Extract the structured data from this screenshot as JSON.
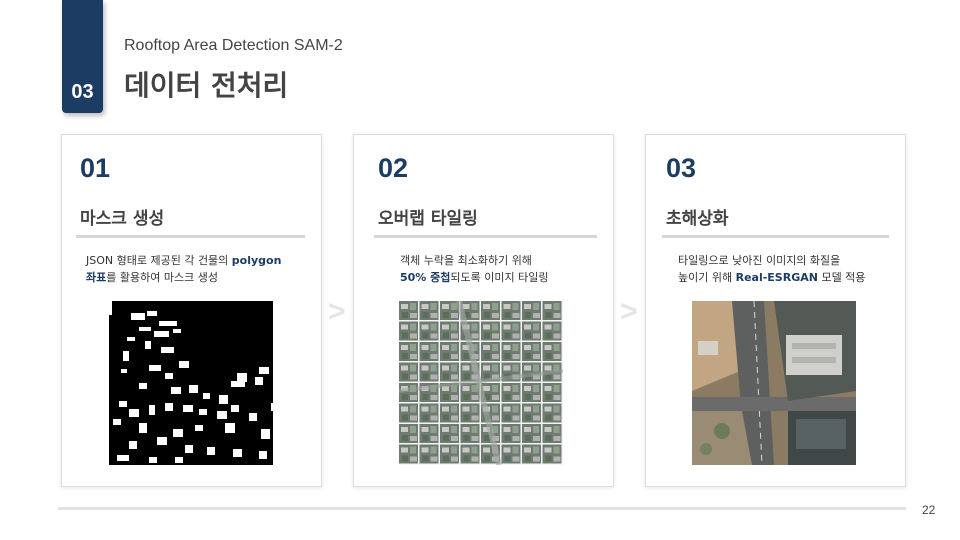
{
  "section": {
    "number": "03",
    "subtitle": "Rooftop Area Detection SAM-2",
    "title": "데이터 전처리"
  },
  "steps": [
    {
      "number": "01",
      "heading": "마스크 생성",
      "desc": {
        "line1_plain": "JSON 형태로 제공된 각 건물의 ",
        "line1_bold": "polygon",
        "line2_bold": "좌표",
        "line2_plain": "를 활용하여 마스크 생성"
      },
      "image": "binary-mask-image"
    },
    {
      "number": "02",
      "heading": "오버랩 타일링",
      "desc": {
        "line1_plain": "객체 누락을 최소화하기 위해",
        "line2_bold": "50% 중첩",
        "line2_plain": "되도록 이미지 타일링"
      },
      "image": "tiled-aerial-image"
    },
    {
      "number": "03",
      "heading": "초해상화",
      "desc": {
        "line1_plain": "타일링으로 낮아진 이미지의 화질을",
        "line2_plain1": "높이기 위해 ",
        "line2_bold": "Real-ESRGAN",
        "line2_plain2": " 모델 적용"
      },
      "image": "super-resolved-aerial-image"
    }
  ],
  "arrows": [
    ">",
    ">"
  ],
  "page_number": "22",
  "colors": {
    "accent": "#1d3c63",
    "divider": "#d7d7d7"
  }
}
